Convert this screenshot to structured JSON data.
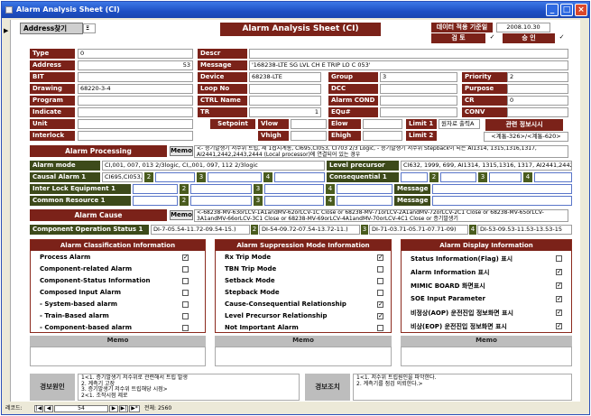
{
  "window": {
    "title": "Alarm Analysis Sheet (CI)"
  },
  "header": {
    "address_search_label": "Address찾기",
    "address_search_value": "Ξ",
    "main_title": "Alarm Analysis Sheet (CI)",
    "date_label": "데이터 적용 기준일",
    "date_value": "2008.10.30",
    "review_label": "검 토",
    "approve_label": "승 인"
  },
  "fields": {
    "type": {
      "label": "Type",
      "value": "0"
    },
    "address": {
      "label": "Address",
      "value": "53"
    },
    "bit": {
      "label": "BIT",
      "value": ""
    },
    "drawing": {
      "label": "Drawing",
      "value": "68220-3-4"
    },
    "program": {
      "label": "Program",
      "value": ""
    },
    "indicate": {
      "label": "Indicate",
      "value": ""
    },
    "unit": {
      "label": "Unit",
      "value": ""
    },
    "interlock": {
      "label": "Interlock",
      "value": ""
    },
    "descr": {
      "label": "Descr",
      "value": ""
    },
    "message": {
      "label": "Message",
      "value": "'168238-LTE SG LVL CH E TRIP LO   C 053'"
    },
    "device": {
      "label": "Device",
      "value": "68238-LTE"
    },
    "loop_no": {
      "label": "Loop No",
      "value": ""
    },
    "ctrl_name": {
      "label": "CTRL Name",
      "value": ""
    },
    "tr": {
      "label": "TR",
      "value": "1"
    },
    "setpoint": {
      "label": "Setpoint"
    },
    "vlow": {
      "label": "Vlow",
      "value": ""
    },
    "vhigh": {
      "label": "Vhigh",
      "value": ""
    },
    "group": {
      "label": "Group",
      "value": "3"
    },
    "dcc": {
      "label": "DCC",
      "value": ""
    },
    "alarm_cond": {
      "label": "Alarm COND",
      "value": ""
    },
    "equ": {
      "label": "EQu#",
      "value": ""
    },
    "elow": {
      "label": "Elow",
      "value": ""
    },
    "ehigh": {
      "label": "Ehigh",
      "value": ""
    },
    "priority": {
      "label": "Priority",
      "value": "2"
    },
    "purpose": {
      "label": "Purpose",
      "value": ""
    },
    "cr": {
      "label": "CR",
      "value": "0"
    },
    "conv": {
      "label": "CONV",
      "value": ""
    },
    "limit1": {
      "label": "Limit 1",
      "value": "원자로 출력A"
    },
    "limit2": {
      "label": "Limit 2",
      "value": "<계통-326>/<계통-620>"
    },
    "related_info": {
      "label": "관련 정보시시"
    }
  },
  "alarm_processing": {
    "label": "Alarm Processing",
    "memo_label": "Memo",
    "memo_text": "<- 증기발생기 저수위 트립, 제 1접지계통, CI695,CI053, CI703 2/3 Logic, - 증기발생기 저수위 Stepback이 되는 AI1314, 1315,1316,1317, AI2441,2442,2443,2444 (Local processor)에 연결되어 있는 경우"
  },
  "alarm_mode": {
    "label": "Alarm mode",
    "value": "CI,001, 007, 013 2/3logic, CI,,001, 097, 112 2/3logic"
  },
  "level_precursor": {
    "label": "Level precursor",
    "value": "CI632, 1999, 699, AI1314, 1315,1316, 1317, AI2441,2442,2443"
  },
  "causal_alarm": {
    "label": "Causal Alarm 1",
    "value": "CI695,CI053,",
    "n2": "2",
    "n3": "3",
    "n4": "4"
  },
  "consequential": {
    "label": "Consequential 1",
    "n2": "2",
    "n3": "3",
    "n4": "4"
  },
  "interlock_equipment": {
    "label": "Inter Lock Equipment 1",
    "n2": "2",
    "n3": "3",
    "n4": "4",
    "message_label": "Message"
  },
  "common_resource": {
    "label": "Common Resource 1",
    "n2": "2",
    "n3": "3",
    "n4": "4",
    "message_label": "Message"
  },
  "alarm_cause": {
    "label": "Alarm Cause",
    "memo_label": "Memo",
    "memo_text": "<-68238-MV-63orLCV-1A1andMV-62orLCV-1C Close or 68238-MV-71orLCV-2A1andMV-72orLCV-2C1 Close or 68238-MV-65orLCV-3A1andMV-66orLCV-3C1 Close or 68238-MV-69orLCV-4A1andMV-70orLCV-4C1 Close or 증기발생기"
  },
  "component_status": {
    "label": "Component Operation Status 1",
    "v1": "DI-7-05.54-11.72-09.54-15.)",
    "n2": "2",
    "v2": "DI-54-09.72-07.54-13.72-11.)",
    "n3": "3",
    "v3": "DI-71-03.71-05.71-07.71-09)",
    "n4": "4",
    "v4": "DI-53-09.53-11.53-13.53-15"
  },
  "classification": {
    "title": "Alarm Classification Information",
    "items": [
      {
        "label": "Process Alarm",
        "checked": true
      },
      {
        "label": "Component-related Alarm",
        "checked": false
      },
      {
        "label": "Component-Status Information",
        "checked": false
      },
      {
        "label": "Composed Input Alarm",
        "checked": false
      },
      {
        "label": "- System-based alarm",
        "checked": false
      },
      {
        "label": "- Train-Based alarm",
        "checked": false
      },
      {
        "label": "- Component-based alarm",
        "checked": false
      }
    ]
  },
  "suppression": {
    "title": "Alarm Suppression Mode Information",
    "items": [
      {
        "label": "Rx Trip Mode",
        "checked": true
      },
      {
        "label": "TBN Trip Mode",
        "checked": false
      },
      {
        "label": "Setback Mode",
        "checked": false
      },
      {
        "label": "Stepback Mode",
        "checked": false
      },
      {
        "label": "Cause-Consequential Relationship",
        "checked": true
      },
      {
        "label": "Level Precursor Relationship",
        "checked": true
      },
      {
        "label": "Not Important Alarm",
        "checked": false
      }
    ]
  },
  "display": {
    "title": "Alarm Display Information",
    "items": [
      {
        "label": "Status Information(Flag) 표시",
        "checked": false
      },
      {
        "label": "Alarm Information 표시",
        "checked": true
      },
      {
        "label": "MIMIC BOARD 화면표시",
        "checked": true
      },
      {
        "label": "SOE Input Parameter",
        "checked": true
      },
      {
        "label": "비정상(AOP) 운전진입 정보화면 표시",
        "checked": true
      },
      {
        "label": "비상(EOP) 운전진입 정보화면 표시",
        "checked": true
      }
    ]
  },
  "memos": {
    "memo1": "Memo",
    "memo2": "Memo",
    "memo3": "Memo"
  },
  "alarm_cause_text": {
    "label": "경보원인",
    "lines": [
      "1<1. 증기발생기 저수위로 관련해서 트립 발생",
      "2. 계측기 고장",
      "3. 증기발생기 저수위 트립해당 시점>",
      "2<1. 조작시점 제로"
    ]
  },
  "alarm_action": {
    "label": "경보조치",
    "lines": [
      "1<1. 저수위 트립원인을 파악한다.",
      "2. 계측기를 점검 의뢰한다.>"
    ]
  },
  "statusbar": {
    "record_label": "레코드:",
    "record_value": "54",
    "total_label": "전체: 2560"
  }
}
